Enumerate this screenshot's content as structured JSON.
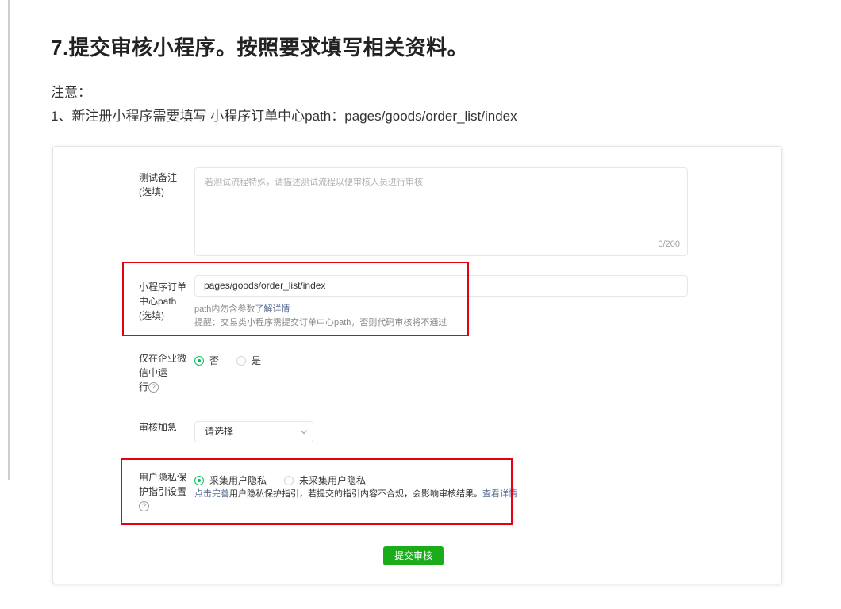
{
  "heading": "7.提交审核小程序。按照要求填写相关资料。",
  "note_label": "注意：",
  "note_line": "1、新注册小程序需要填写 小程序订单中心path：pages/goods/order_list/index",
  "form": {
    "test_note": {
      "label_line1": "测试备注",
      "label_line2": "(选填)",
      "placeholder": "若测试流程特殊，请描述测试流程以便审核人员进行审核",
      "counter": "0/200"
    },
    "order_path": {
      "label_line1": "小程序订单",
      "label_line2": "中心path",
      "label_line3": "(选填)",
      "value": "pages/goods/order_list/index",
      "tip1_prefix": "path内勿含参数",
      "tip1_link": "了解详情",
      "tip2": "提醒：交易类小程序需提交订单中心path，否则代码审核将不通过"
    },
    "wework_only": {
      "label_line1": "仅在企业微",
      "label_line2": "信中运",
      "label_line3": "行",
      "option_no": "否",
      "option_yes": "是",
      "selected": "否"
    },
    "expedite": {
      "label": "审核加急",
      "value": "请选择"
    },
    "privacy": {
      "label_line1": "用户隐私保",
      "label_line2": "护指引设置",
      "option_collect": "采集用户隐私",
      "option_no_collect": "未采集用户隐私",
      "selected": "采集用户隐私",
      "tip_link1": "点击完善",
      "tip_text": "用户隐私保护指引，若提交的指引内容不合规，会影响审核结果。",
      "tip_link2": "查看详情"
    },
    "submit_label": "提交审核"
  },
  "icons": {
    "help": "question-circle-icon",
    "dropdown": "chevron-down-icon"
  },
  "colors": {
    "accent_green": "#07c160",
    "button_green": "#1aad19",
    "link_blue": "#576b95",
    "highlight_red": "#e60012"
  }
}
